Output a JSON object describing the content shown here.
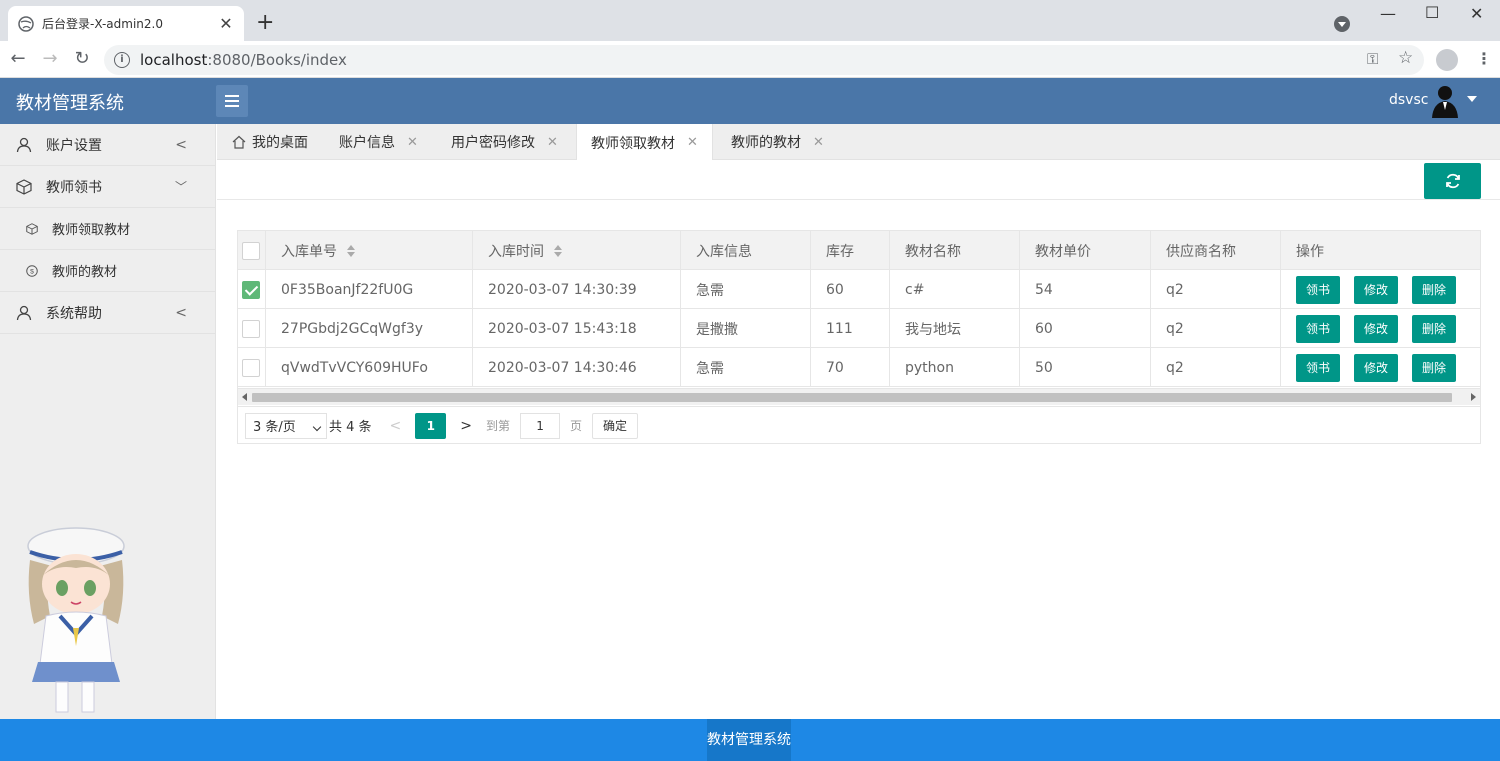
{
  "browser": {
    "tab_title": "后台登录-X-admin2.0",
    "tab_close": "✕",
    "new_tab": "+",
    "url_host": "localhost",
    "url_rest": ":8080/Books/index"
  },
  "header": {
    "logo": "教材管理系统",
    "username": "dsvsc"
  },
  "sidebar": {
    "items": [
      {
        "label": "账户设置"
      },
      {
        "label": "教师领书"
      },
      {
        "label": "教师领取教材"
      },
      {
        "label": "教师的教材"
      },
      {
        "label": "系统帮助"
      }
    ]
  },
  "tabs": [
    {
      "label": "我的桌面"
    },
    {
      "label": "账户信息"
    },
    {
      "label": "用户密码修改"
    },
    {
      "label": "教师领取教材"
    },
    {
      "label": "教师的教材"
    }
  ],
  "table": {
    "headers": [
      "入库单号",
      "入库时间",
      "入库信息",
      "库存",
      "教材名称",
      "教材单价",
      "供应商名称",
      "操作"
    ],
    "rows": [
      {
        "checked": true,
        "id": "0F35BoanJf22fU0G",
        "time": "2020-03-07 14:30:39",
        "info": "急需",
        "stock": "60",
        "name": "c#",
        "price": "54",
        "supplier": "q2"
      },
      {
        "checked": false,
        "id": "27PGbdj2GCqWgf3y",
        "time": "2020-03-07 15:43:18",
        "info": "是撒撒",
        "stock": "111",
        "name": "我与地坛",
        "price": "60",
        "supplier": "q2"
      },
      {
        "checked": false,
        "id": "qVwdTvVCY609HUFo",
        "time": "2020-03-07 14:30:46",
        "info": "急需",
        "stock": "70",
        "name": "python",
        "price": "50",
        "supplier": "q2"
      }
    ],
    "actions": {
      "take": "领书",
      "edit": "修改",
      "delete": "删除"
    }
  },
  "pager": {
    "page_size": "3 条/页",
    "total": "共 4 条",
    "current": "1",
    "goto_label": "到第",
    "goto_value": "1",
    "page_unit": "页",
    "confirm": "确定"
  },
  "footer": {
    "text": "教材管理系统"
  },
  "colors": {
    "header": "#4a76a8",
    "accent": "#009688",
    "footer": "#1e88e5",
    "checkbox": "#5fb878"
  }
}
